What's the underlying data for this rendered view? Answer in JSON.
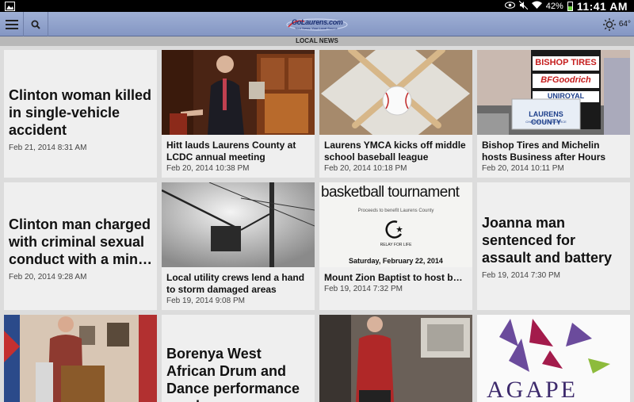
{
  "status_bar": {
    "battery": "42%",
    "time": "11:41 AM"
  },
  "app_bar": {
    "logo_text": "GoLaurens.com",
    "logo_sub": "Your News. Your Local Source",
    "temperature": "64°"
  },
  "section": {
    "title": "LOCAL NEWS"
  },
  "articles": [
    {
      "title": "Clinton woman killed in single-vehicle accident",
      "date": "Feb 21, 2014 8:31 AM"
    },
    {
      "title": "Hitt lauds Laurens County at LCDC annual meeting",
      "date": "Feb 20, 2014 10:38 PM"
    },
    {
      "title": "Laurens YMCA kicks off middle school baseball league",
      "date": "Feb 20, 2014 10:18 PM"
    },
    {
      "title": "Bishop Tires and Michelin hosts Business after Hours",
      "date": "Feb 20, 2014 10:11 PM"
    },
    {
      "title": "Clinton man charged with criminal sexual conduct with a min…",
      "date": "Feb 20, 2014 9:28 AM"
    },
    {
      "title": "Local utility crews lend a hand to storm damaged areas",
      "date": "Feb 19, 2014 9:08 PM"
    },
    {
      "title": "Mount Zion Baptist to host basketball tournament to bene…",
      "date": "Feb 19, 2014 7:32 PM"
    },
    {
      "title": "Joanna man sentenced for assault and battery",
      "date": "Feb 19, 2014 7:30 PM"
    },
    {
      "title": "Borenya West African Drum and Dance performance resch…",
      "date": ""
    }
  ],
  "images": {
    "tires_sign_1": "BISHOP TIRES",
    "tires_sign_2": "BFGoodrich",
    "tires_sign_3": "UNIROYAL",
    "tires_sign_4": "Business After Hours",
    "tires_banner": "LAURENS COUNTY",
    "tires_banner_sub": "CHAMBER OF COMMERCE",
    "bball_heading": "basketball tournament",
    "bball_sub": "Proceeds to benefit Laurens County",
    "bball_relay": "RELAY FOR LIFE",
    "bball_date": "Saturday, February 22, 2014",
    "agape_text": "AGAPE"
  }
}
